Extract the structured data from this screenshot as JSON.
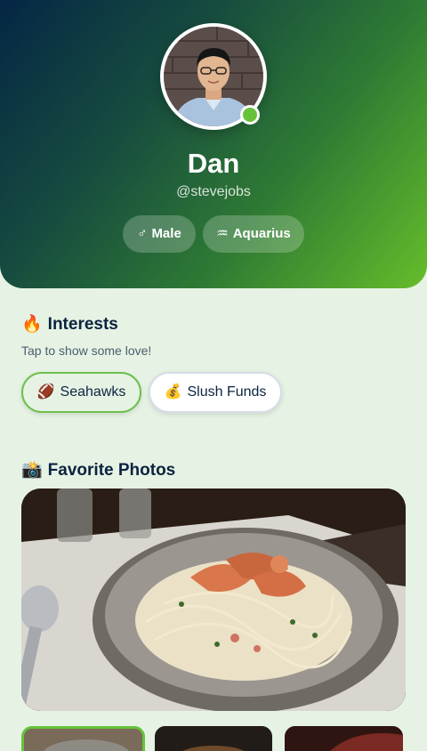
{
  "profile": {
    "name": "Dan",
    "handle": "@stevejobs",
    "online": true,
    "tags": {
      "gender": {
        "symbol": "♂",
        "label": "Male"
      },
      "zodiac": {
        "symbol": "♒",
        "label": "Aquarius"
      }
    }
  },
  "interests": {
    "emoji": "🔥",
    "title": "Interests",
    "subtitle": "Tap to show some love!",
    "items": [
      {
        "emoji": "🏈",
        "label": "Seahawks",
        "selected": true
      },
      {
        "emoji": "💰",
        "label": "Slush Funds",
        "selected": false
      }
    ]
  },
  "photos": {
    "emoji": "📸",
    "title": "Favorite Photos"
  },
  "colors": {
    "accent": "#67c23a",
    "background": "#e6f3e4",
    "header_start": "#052645",
    "header_end": "#66bd2a",
    "text": "#0b2340"
  }
}
